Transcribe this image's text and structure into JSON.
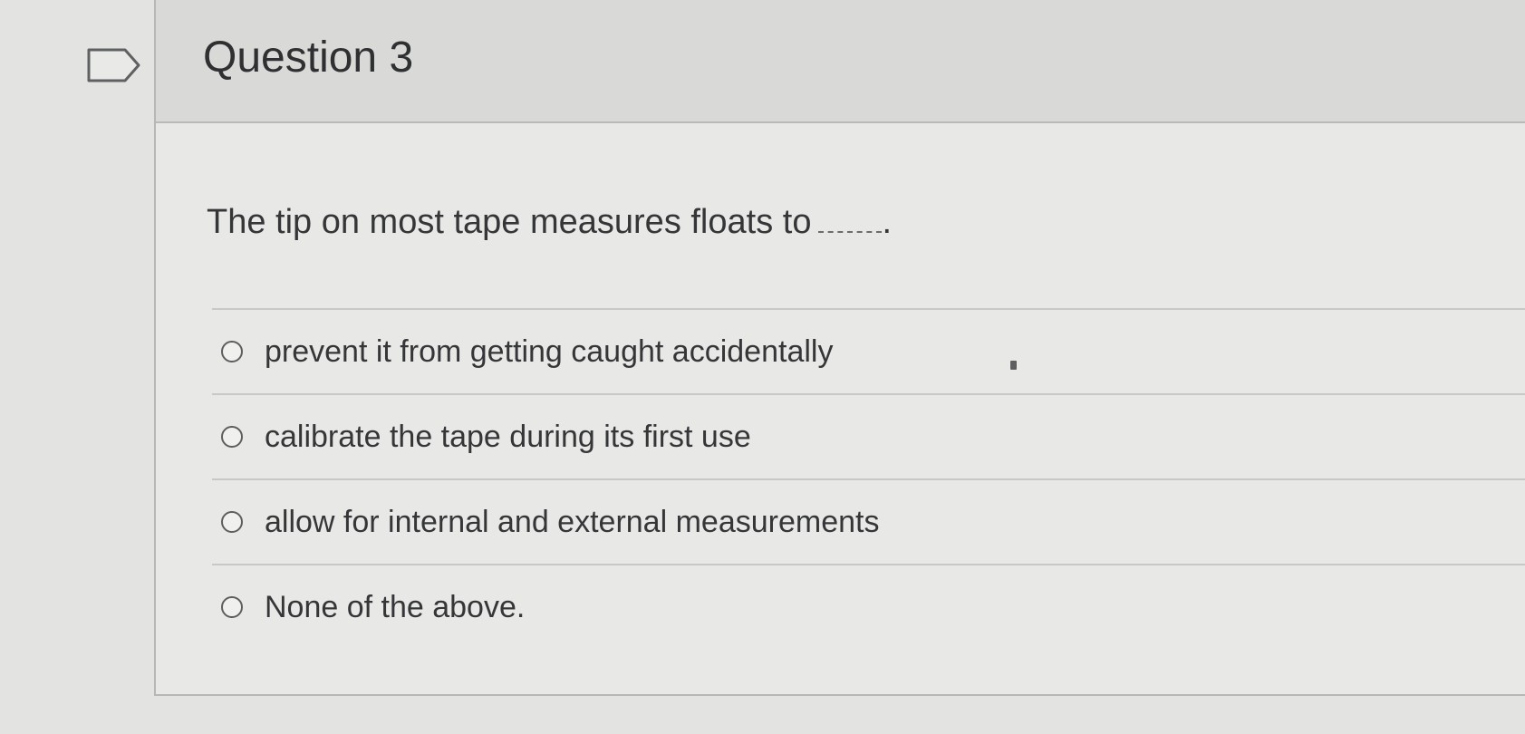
{
  "question": {
    "title": "Question 3",
    "prompt": "The tip on most tape measures floats to",
    "prompt_end": ".",
    "answers": [
      {
        "label": "prevent it from getting caught accidentally",
        "selected": false
      },
      {
        "label": "calibrate the tape during its first use",
        "selected": false
      },
      {
        "label": "allow for internal and external measurements",
        "selected": false
      },
      {
        "label": "None of the above.",
        "selected": false
      }
    ]
  },
  "icons": {
    "flag": "flag-icon",
    "radio": "radio-button"
  }
}
